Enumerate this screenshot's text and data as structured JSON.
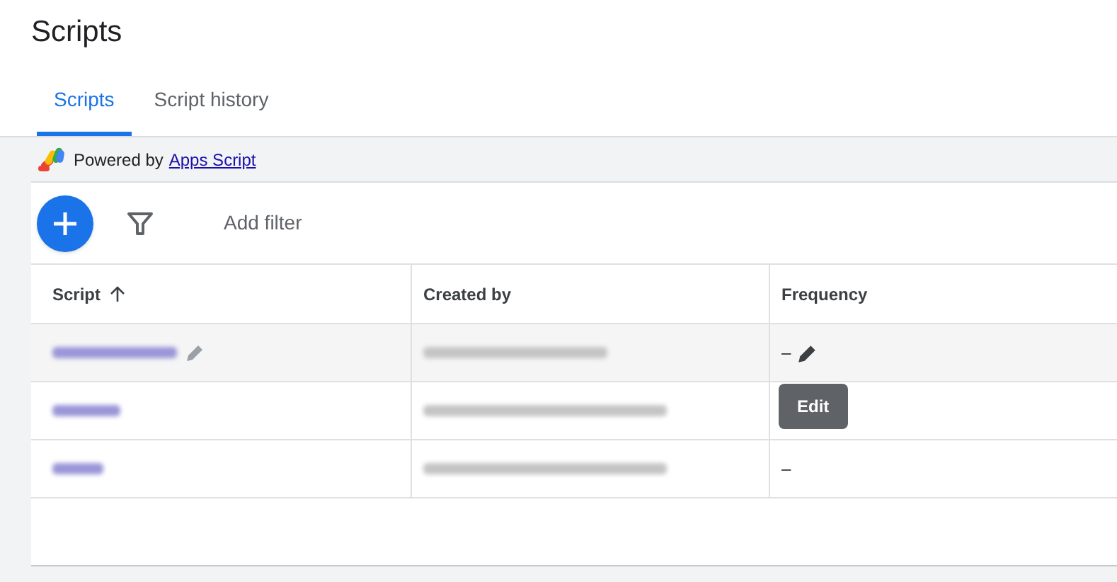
{
  "title": "Scripts",
  "tabs": [
    {
      "label": "Scripts",
      "selected": true
    },
    {
      "label": "Script history",
      "selected": false
    }
  ],
  "powered_by": {
    "prefix": "Powered by",
    "link": "Apps Script"
  },
  "toolbar": {
    "add_filter": "Add filter"
  },
  "table": {
    "columns": [
      {
        "label": "Script",
        "sorted": true
      },
      {
        "label": "Created by",
        "sorted": false
      },
      {
        "label": "Frequency",
        "sorted": false
      }
    ],
    "rows": [
      {
        "frequency": "–",
        "hovered": true
      },
      {
        "frequency": "",
        "hovered": false
      },
      {
        "frequency": "–",
        "hovered": false
      }
    ]
  },
  "tooltip": {
    "text": "Edit"
  }
}
